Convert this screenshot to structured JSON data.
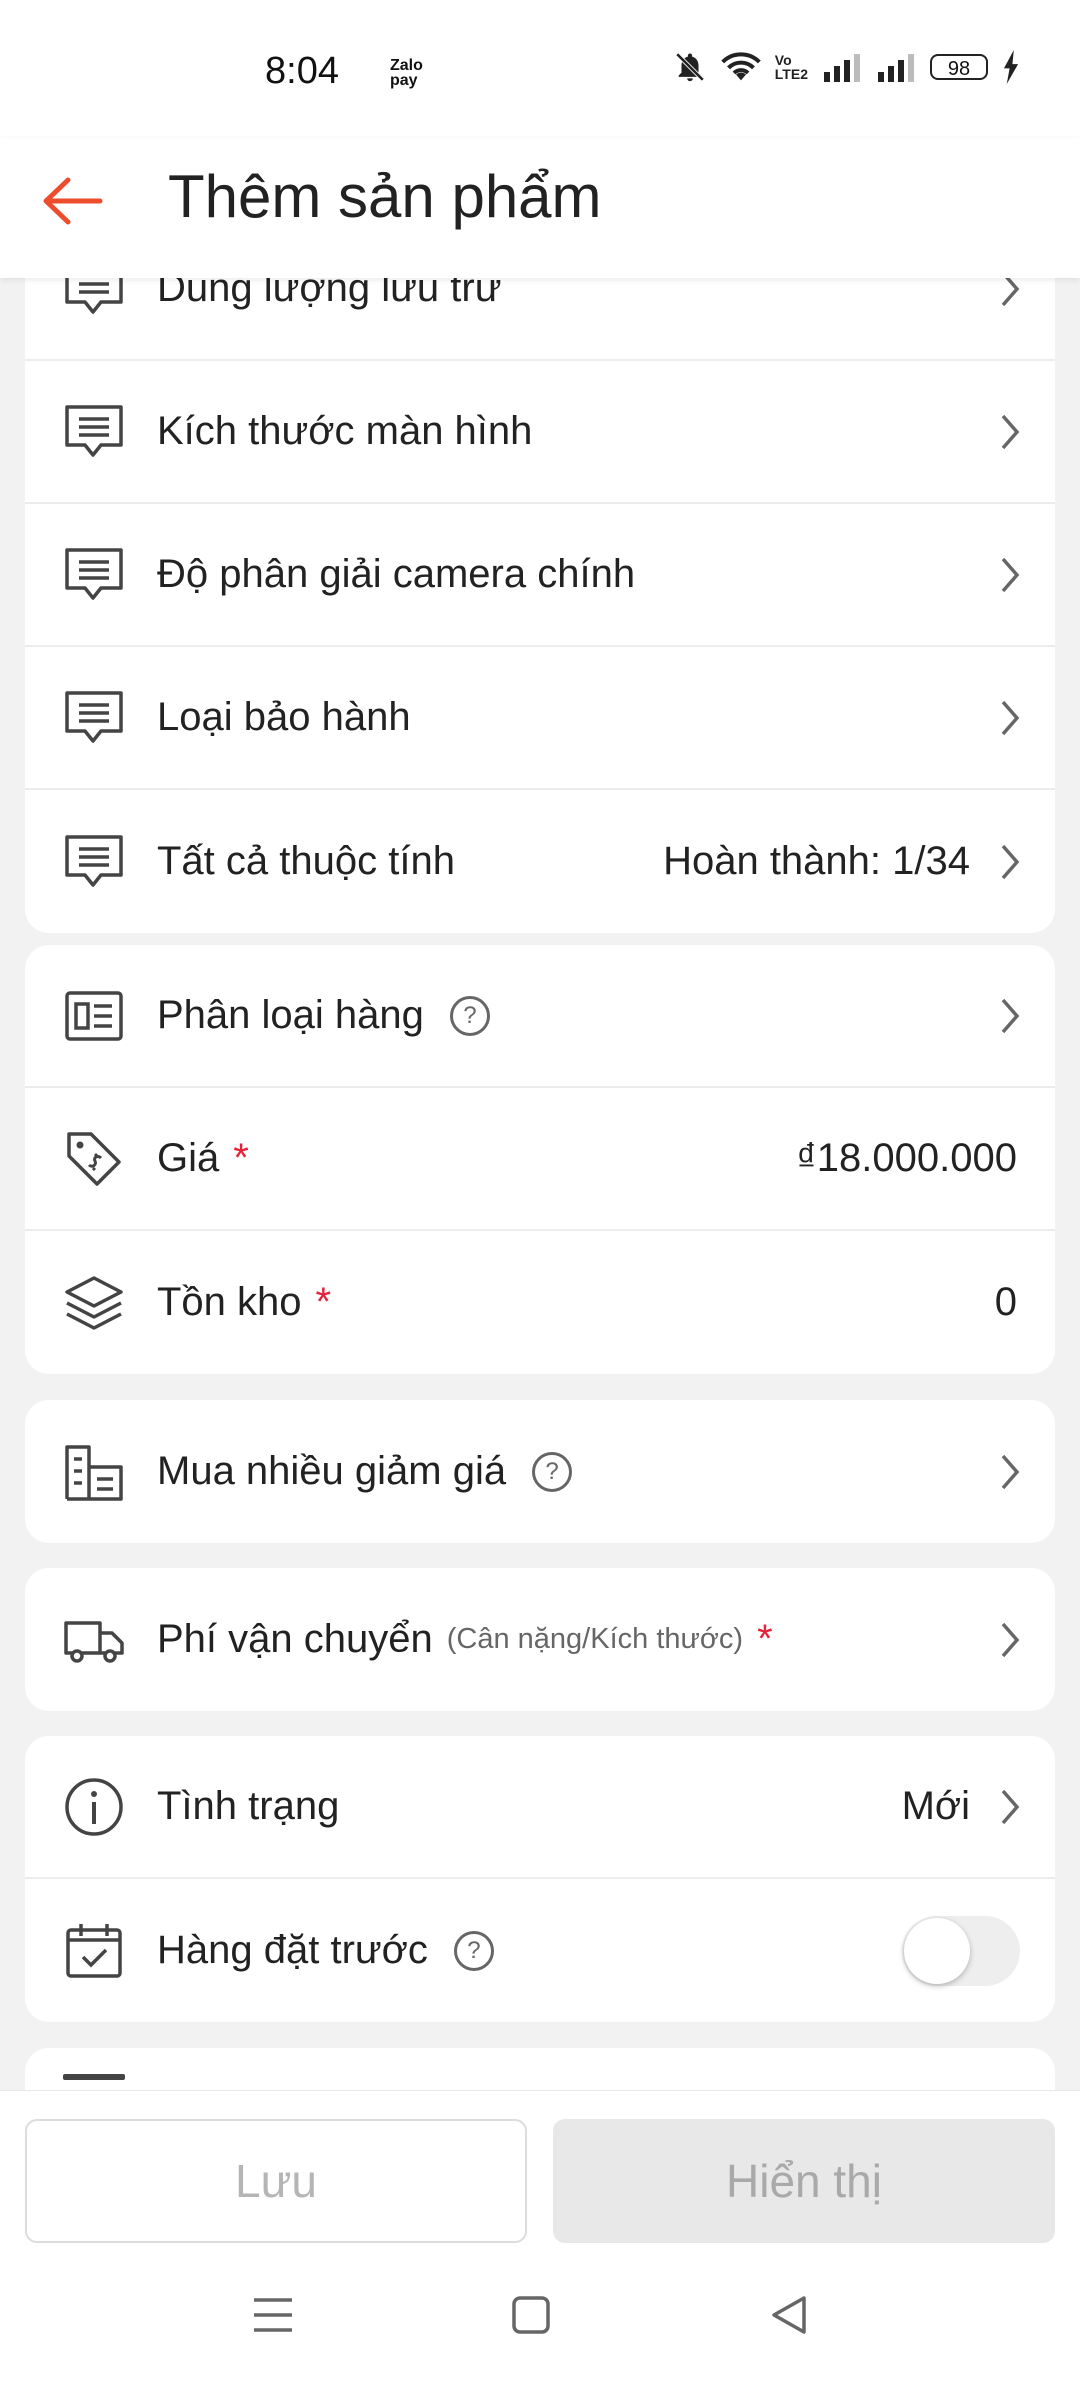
{
  "status": {
    "time": "8:04",
    "zalo": "Zalo\npay",
    "battery": "98"
  },
  "header": {
    "title": "Thêm sản phẩm"
  },
  "attributes": {
    "items": [
      {
        "label": "Dung lượng lưu trữ"
      },
      {
        "label": "Kích thước màn hình"
      },
      {
        "label": "Độ phân giải camera chính"
      },
      {
        "label": "Loại bảo hành"
      },
      {
        "label": "Tất cả thuộc tính",
        "value": "Hoàn thành: 1/34"
      }
    ]
  },
  "product": {
    "classification": {
      "label": "Phân loại hàng",
      "help": "?"
    },
    "price": {
      "label": "Giá",
      "required": "*",
      "value": "₫18.000.000"
    },
    "stock": {
      "label": "Tồn kho",
      "required": "*",
      "value": "0"
    }
  },
  "discount": {
    "label": "Mua nhiều giảm giá",
    "help": "?"
  },
  "shipping": {
    "label": "Phí vận chuyển",
    "sub": "(Cân nặng/Kích thước)",
    "required": "*"
  },
  "condition": {
    "label": "Tình trạng",
    "value": "Mới"
  },
  "preorder": {
    "label": "Hàng đặt trước",
    "help": "?",
    "enabled": false
  },
  "actions": {
    "save": "Lưu",
    "show": "Hiển thị"
  },
  "colors": {
    "accent": "#ee4d2d",
    "required": "#e5223a"
  }
}
